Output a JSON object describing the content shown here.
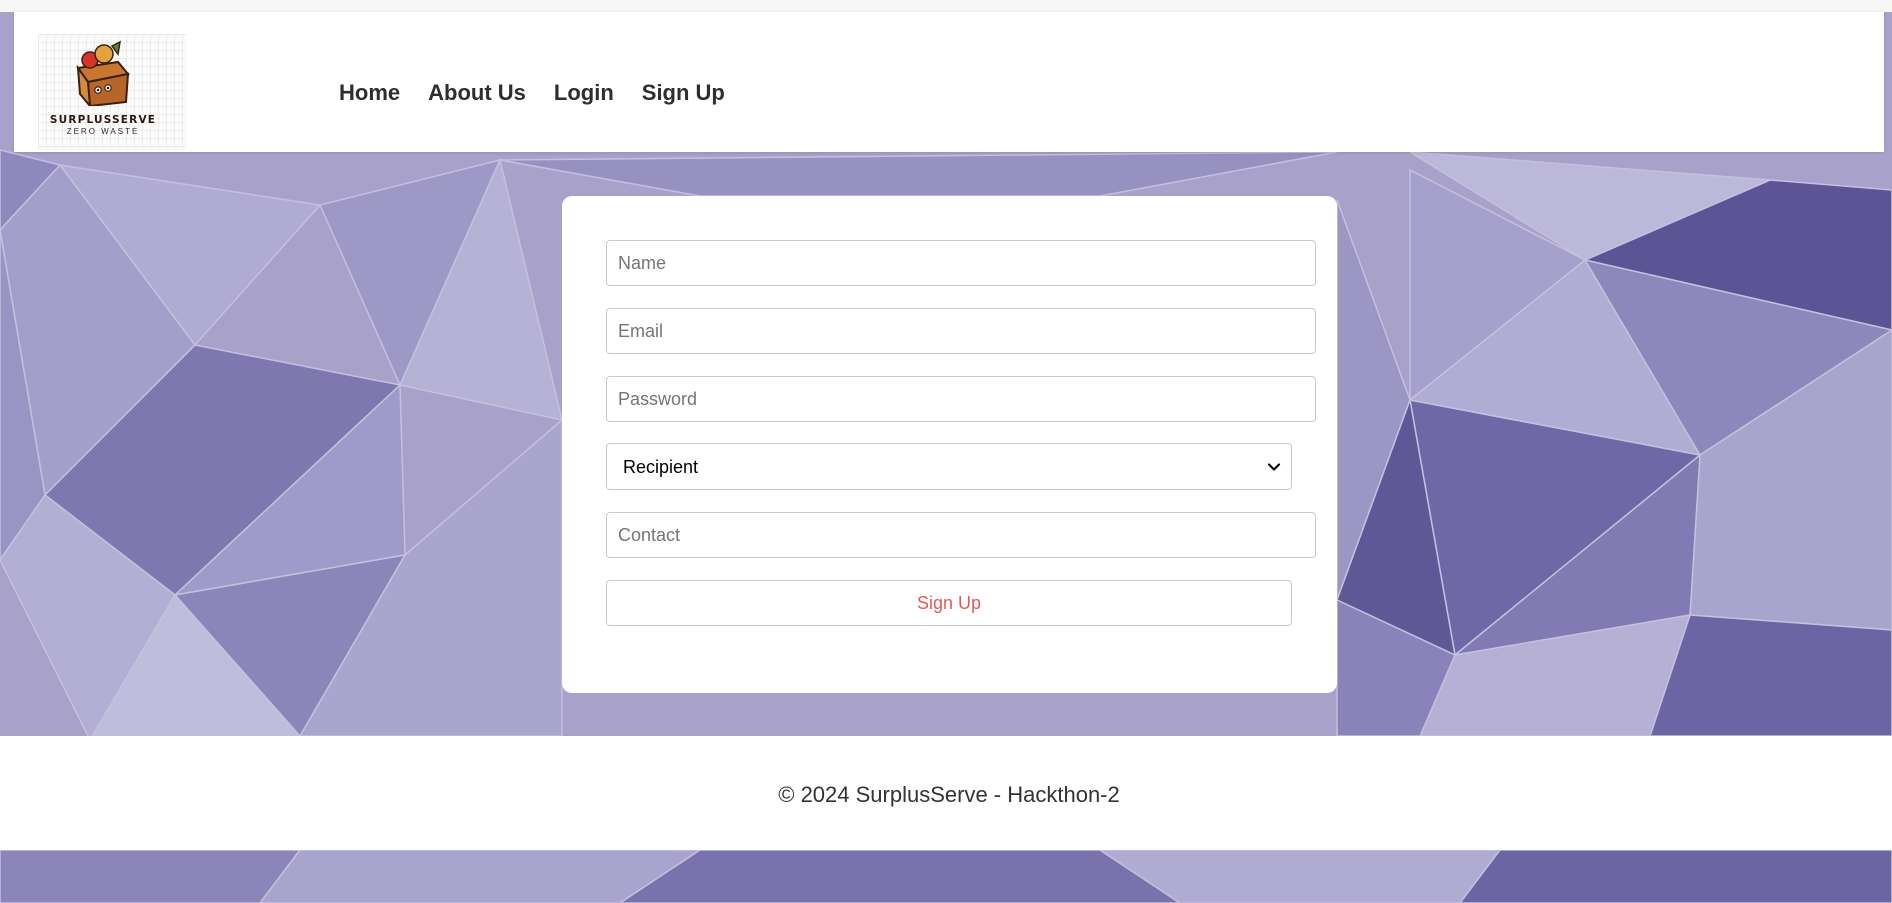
{
  "brand": {
    "name": "SURPLUSSERVE",
    "tagline": "ZERO WASTE"
  },
  "nav": {
    "items": [
      {
        "label": "Home"
      },
      {
        "label": "About Us"
      },
      {
        "label": "Login"
      },
      {
        "label": "Sign Up"
      }
    ]
  },
  "signup_form": {
    "name": {
      "placeholder": "Name",
      "value": ""
    },
    "email": {
      "placeholder": "Email",
      "value": ""
    },
    "password": {
      "placeholder": "Password",
      "value": ""
    },
    "role": {
      "selected": "Recipient"
    },
    "contact": {
      "placeholder": "Contact",
      "value": ""
    },
    "submit_label": "Sign Up"
  },
  "footer": {
    "text": "© 2024 SurplusServe - Hackthon-2"
  },
  "colors": {
    "background_light": "#b3aed2",
    "background_mid": "#9e97c4",
    "background_dark": "#5d5593",
    "submit_text": "#e05a52",
    "nav_text": "#2e2e2e"
  }
}
